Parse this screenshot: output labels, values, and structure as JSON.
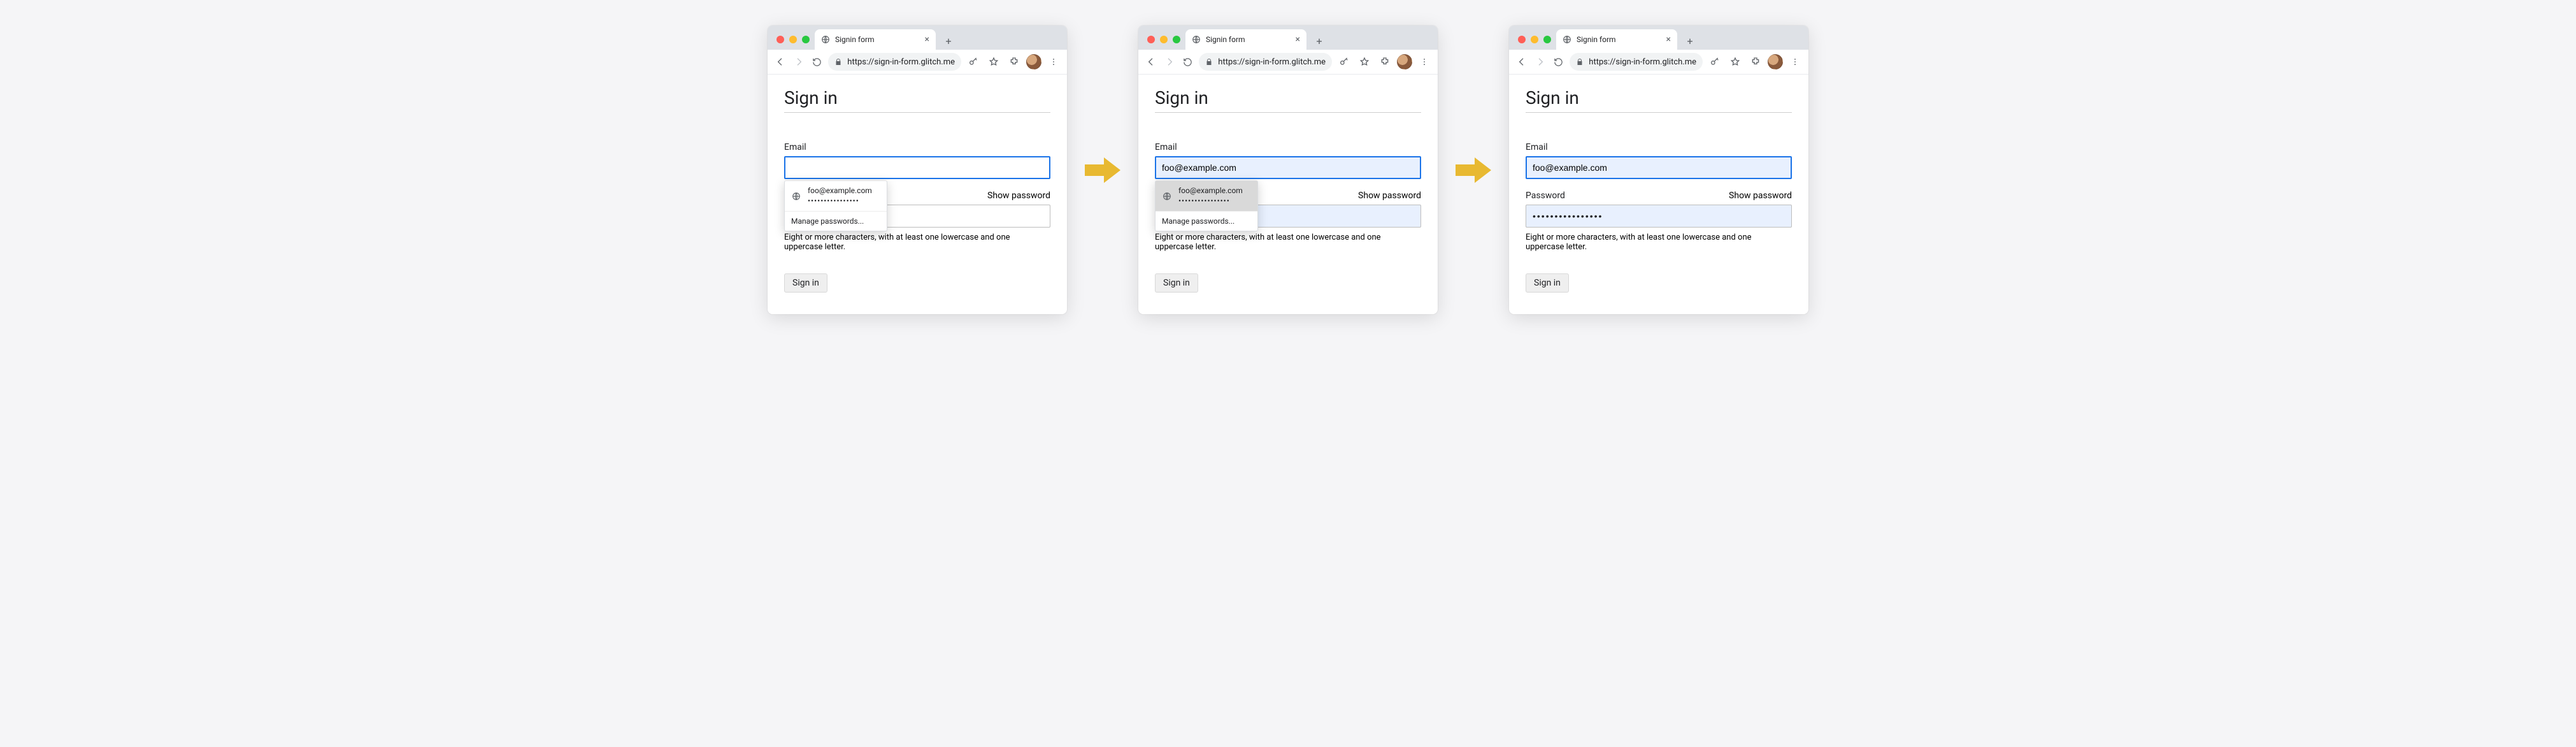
{
  "browser": {
    "tab_title": "Signin form",
    "url": "https://sign-in-form.glitch.me",
    "new_tab_label": "+",
    "close_tab_label": "×"
  },
  "form": {
    "heading": "Sign in",
    "email_label": "Email",
    "password_label": "Password",
    "show_password": "Show password",
    "hint": "Eight or more characters, with at least one lowercase and one uppercase letter.",
    "submit_label": "Sign in"
  },
  "autofill": {
    "suggestion_email": "foo@example.com",
    "suggestion_password_mask": "••••••••••••••••",
    "manage_label": "Manage passwords..."
  },
  "states": {
    "s1": {
      "email_value": "",
      "password_value": "",
      "popup_hover": false
    },
    "s2": {
      "email_value": "foo@example.com",
      "password_value": "",
      "popup_hover": true
    },
    "s3": {
      "email_value": "foo@example.com",
      "password_value": "••••••••••••••••"
    }
  }
}
